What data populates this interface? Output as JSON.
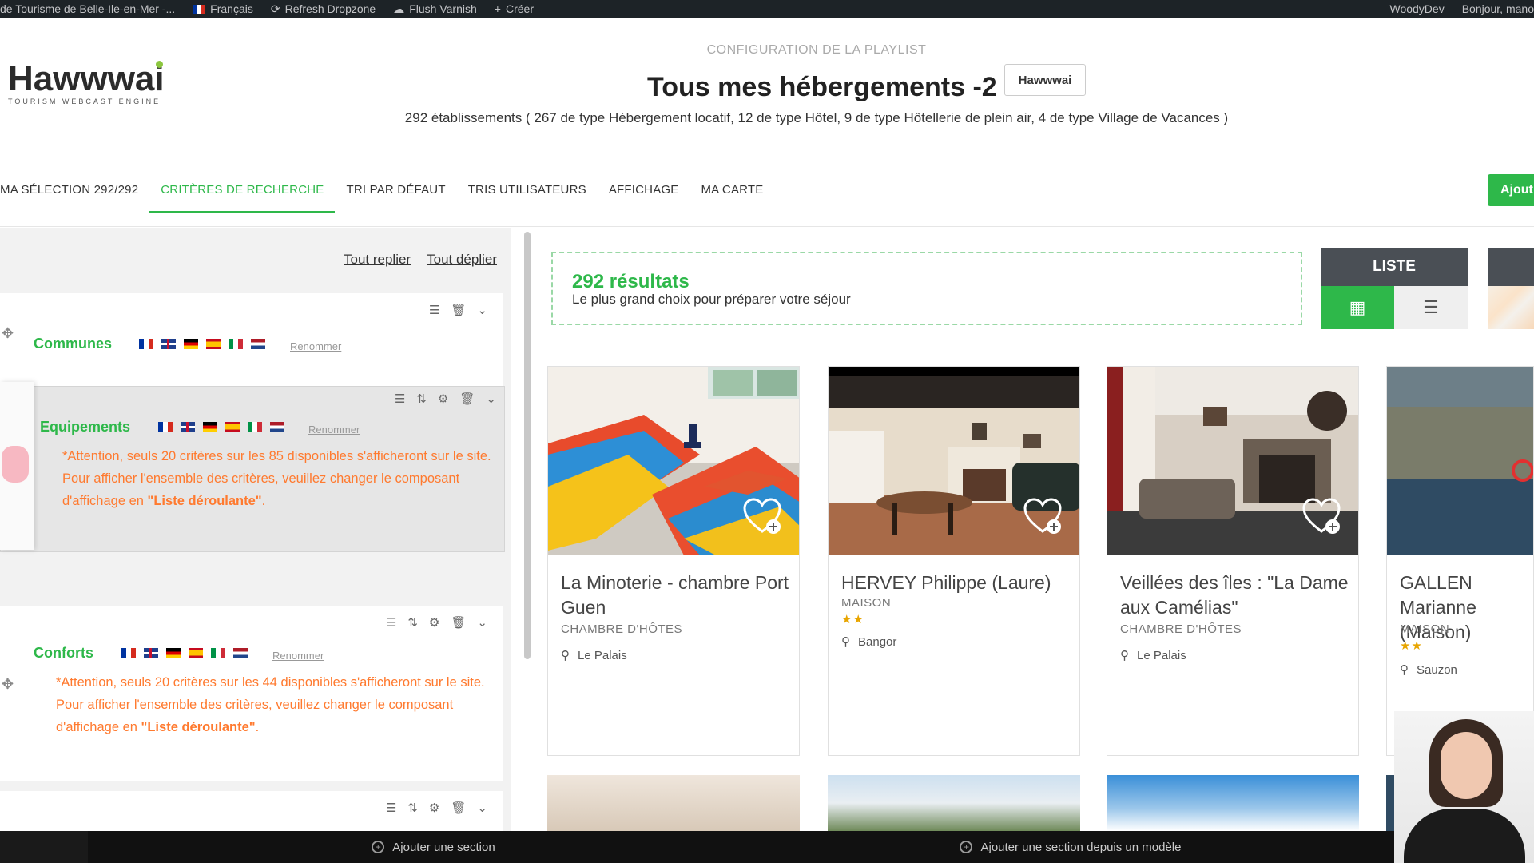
{
  "adminbar": {
    "site": "de Tourisme de Belle-Ile-en-Mer -...",
    "lang": "Français",
    "refresh": "Refresh Dropzone",
    "flush": "Flush Varnish",
    "create": "Créer",
    "user1": "WoodyDev",
    "user2": "Bonjour, mano"
  },
  "header": {
    "logo_text": "Hawwwai",
    "logo_sub": "TOURISM WEBCAST ENGINE",
    "config_label": "CONFIGURATION DE LA PLAYLIST",
    "title": "Tous mes hébergements -2",
    "badge": "Hawwwai",
    "summary": "292 établissements ( 267 de type Hébergement locatif, 12 de type Hôtel, 9 de type Hôtellerie de plein air, 4 de type Village de Vacances )"
  },
  "tabs": [
    {
      "label": "MA SÉLECTION 292/292"
    },
    {
      "label": "CRITÈRES DE RECHERCHE"
    },
    {
      "label": "TRI PAR DÉFAUT"
    },
    {
      "label": "TRIS UTILISATEURS"
    },
    {
      "label": "AFFICHAGE"
    },
    {
      "label": "MA CARTE"
    }
  ],
  "add_button": "Ajout",
  "left": {
    "collapse_all": "Tout replier",
    "expand_all": "Tout déplier",
    "rename": "Renommer",
    "sections": [
      {
        "title": "Communes"
      },
      {
        "title": "Equipements",
        "warn1": "*Attention, seuls 20 critères sur les 85 disponibles s'afficheront sur le site.",
        "warn2a": "Pour afficher l'ensemble des critères, veuillez changer le composant d'affichage en ",
        "warn2b": "\"Liste déroulante\"",
        "warn2c": "."
      },
      {
        "title": "Conforts",
        "warn1": "*Attention, seuls 20 critères sur les 44 disponibles s'afficheront sur le site.",
        "warn2a": "Pour afficher l'ensemble des critères, veuillez changer le composant d'affichage en ",
        "warn2b": "\"Liste déroulante\"",
        "warn2c": "."
      }
    ]
  },
  "results": {
    "count": "292 résultats",
    "subtitle": "Le plus grand choix pour préparer votre séjour"
  },
  "view": {
    "label": "LISTE"
  },
  "cards": [
    {
      "name": "La Minoterie - chambre Port Guen",
      "type": "CHAMBRE D'HÔTES",
      "stars": "",
      "location": "Le Palais"
    },
    {
      "name": "HERVEY Philippe (Laure)",
      "type": "MAISON",
      "stars": "★★",
      "location": "Bangor"
    },
    {
      "name": "Veillées des îles : \"La Dame aux Camélias\"",
      "type": "CHAMBRE D'HÔTES",
      "stars": "",
      "location": "Le Palais"
    },
    {
      "name": "GALLEN Marianne (Maison)",
      "type": "MAISON",
      "stars": "★★",
      "location": "Sauzon"
    }
  ],
  "bottom": {
    "add_section": "Ajouter une section",
    "add_from_model": "Ajouter une section depuis un modèle"
  },
  "colors": {
    "accent": "#2eb84a",
    "warning": "#ff7a2f",
    "dark": "#1d2327"
  }
}
